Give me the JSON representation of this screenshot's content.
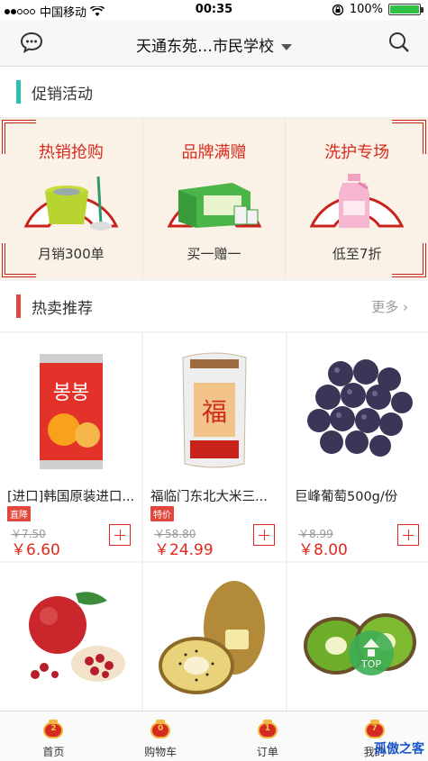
{
  "status": {
    "carrier": "中国移动",
    "time": "00:35",
    "battery": "100%",
    "battery_level": 1.0
  },
  "nav": {
    "title": "天通东苑…市民学校"
  },
  "promo_section": {
    "title": "促销活动",
    "accent": "#2ec0b0"
  },
  "promos": [
    {
      "title": "热销抢购",
      "sub": "月销300单"
    },
    {
      "title": "品牌满赠",
      "sub": "买一赠一"
    },
    {
      "title": "洗护专场",
      "sub": "低至7折"
    }
  ],
  "hot_section": {
    "title": "热卖推荐",
    "more": "更多",
    "accent": "#e3463c"
  },
  "products": [
    {
      "name": "[进口]韩国原装进口...",
      "tag": "直降",
      "old": "￥7.50",
      "price": "￥6.60"
    },
    {
      "name": "福临门东北大米三...",
      "tag": "特价",
      "old": "￥58.80",
      "price": "￥24.99"
    },
    {
      "name": "巨峰葡萄500g/份",
      "tag": "",
      "old": "￥8.99",
      "price": "￥8.00"
    }
  ],
  "top_button": "TOP",
  "tabs": [
    {
      "label": "首页",
      "badge": "2"
    },
    {
      "label": "购物车",
      "badge": "0"
    },
    {
      "label": "订单",
      "badge": "1"
    },
    {
      "label": "我的",
      "badge": "7"
    }
  ],
  "watermark": "孤傲之客"
}
